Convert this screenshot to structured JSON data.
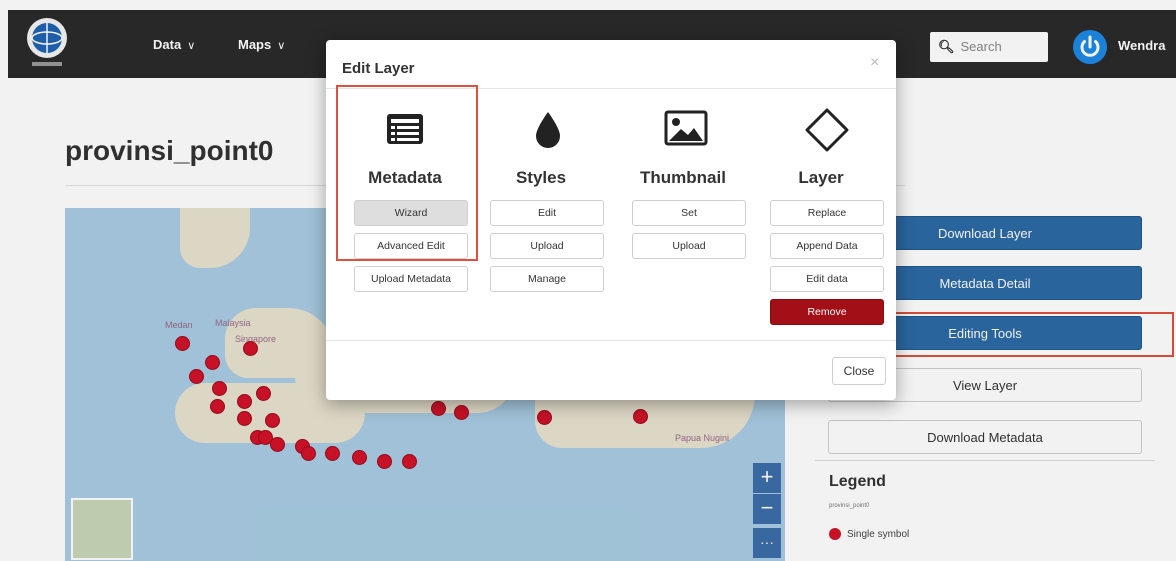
{
  "navbar": {
    "menu": [
      {
        "label": "Data"
      },
      {
        "label": "Maps"
      }
    ],
    "search_placeholder": "Search",
    "user_name": "Wendra"
  },
  "page": {
    "title": "provinsi_point0"
  },
  "map": {
    "labels": [
      "Medan",
      "Malaysia",
      "Singapore",
      "Papua Nugini"
    ],
    "zoom_in": "+",
    "zoom_out": "−",
    "more": "···"
  },
  "sidebar": {
    "buttons": [
      {
        "label": "Download Layer"
      },
      {
        "label": "Metadata Detail"
      },
      {
        "label": "Editing Tools"
      },
      {
        "label": "View Layer"
      },
      {
        "label": "Download Metadata"
      }
    ],
    "legend": {
      "title": "Legend",
      "layer": "provinsi_point0",
      "item": "Single symbol",
      "color": "#d1122a"
    }
  },
  "modal": {
    "title": "Edit Layer",
    "close_x": "×",
    "close_label": "Close",
    "columns": [
      {
        "title": "Metadata",
        "icon": "list-icon",
        "buttons": [
          "Wizard",
          "Advanced Edit",
          "Upload Metadata"
        ]
      },
      {
        "title": "Styles",
        "icon": "drop-icon",
        "buttons": [
          "Edit",
          "Upload",
          "Manage"
        ]
      },
      {
        "title": "Thumbnail",
        "icon": "image-icon",
        "buttons": [
          "Set",
          "Upload"
        ]
      },
      {
        "title": "Layer",
        "icon": "diamond-icon",
        "buttons": [
          "Replace",
          "Append Data",
          "Edit data",
          "Remove"
        ]
      }
    ]
  },
  "colors": {
    "primary": "#2c6aa5",
    "danger": "#a30f16",
    "highlight": "#e0503e",
    "navbar": "#2b2b2b"
  }
}
